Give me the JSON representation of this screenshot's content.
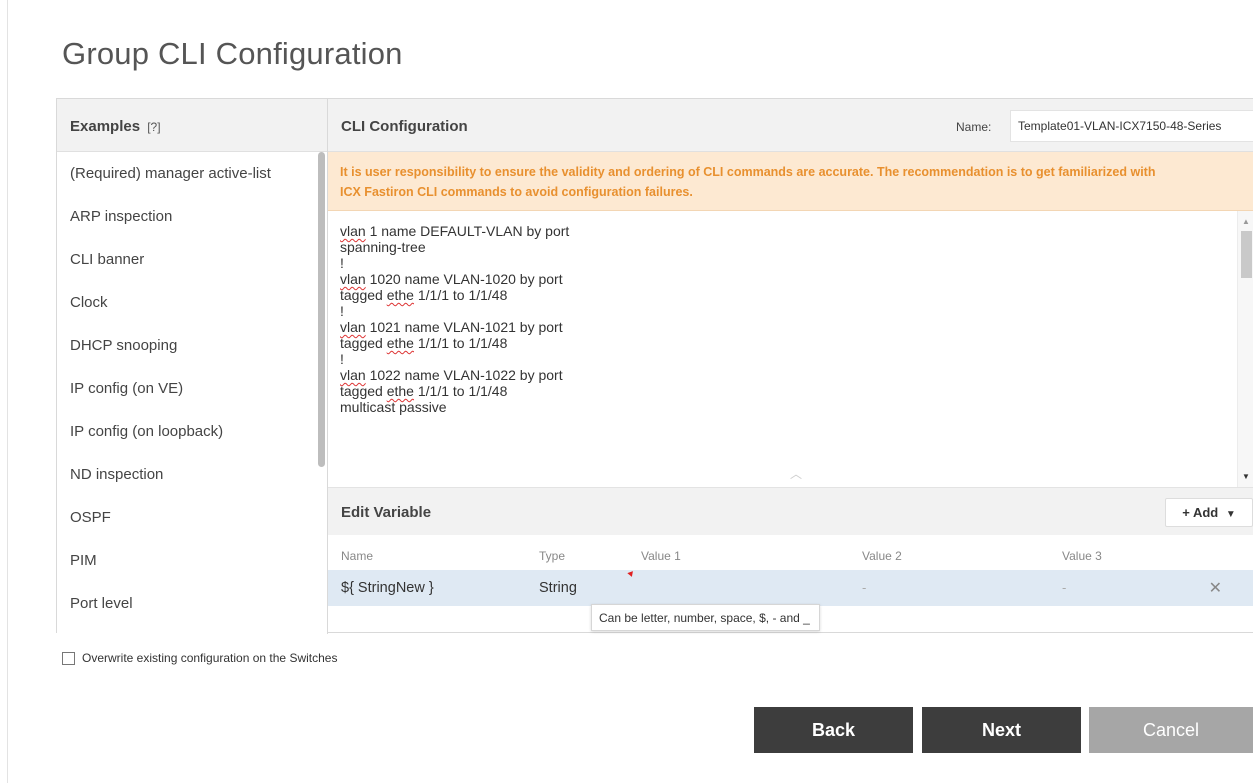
{
  "page": {
    "title": "Group CLI Configuration"
  },
  "examples": {
    "header": "Examples",
    "help": "[?]",
    "items": [
      "(Required) manager active-list",
      "ARP inspection",
      "CLI banner",
      "Clock",
      "DHCP snooping",
      "IP config (on VE)",
      "IP config (on loopback)",
      "ND inspection",
      "OSPF",
      "PIM",
      "Port level"
    ]
  },
  "cli": {
    "header": "CLI Configuration",
    "name_label": "Name:",
    "name_value": "Template01-VLAN-ICX7150-48-Series",
    "warning_line1": "It is user responsibility to ensure the validity and ordering of CLI commands are accurate. The recommendation is to get familiarized with",
    "warning_line2": "ICX Fastiron CLI commands to avoid configuration failures.",
    "lines": [
      {
        "a": "vlan",
        "b": " 1 name DEFAULT-VLAN by port"
      },
      {
        "a": "",
        "b": "spanning-tree"
      },
      {
        "a": "",
        "b": "!"
      },
      {
        "a": "vlan",
        "b": " 1020 name VLAN-1020 by port"
      },
      {
        "a": "tagged ",
        "w": "ethe",
        "b": " 1/1/1 to 1/1/48"
      },
      {
        "a": "",
        "b": "!"
      },
      {
        "a": "vlan",
        "b": " 1021 name VLAN-1021 by port"
      },
      {
        "a": "tagged ",
        "w": "ethe",
        "b": " 1/1/1 to 1/1/48"
      },
      {
        "a": "",
        "b": "!"
      },
      {
        "a": "vlan",
        "b": " 1022 name VLAN-1022 by port"
      },
      {
        "a": "tagged ",
        "w": "ethe",
        "b": " 1/1/1 to 1/1/48"
      },
      {
        "a": "",
        "b": "multicast passive"
      }
    ]
  },
  "edit_variable": {
    "header": "Edit Variable",
    "add_label": "+ Add",
    "add_caret": "▼",
    "columns": {
      "name": "Name",
      "type": "Type",
      "value1": "Value 1",
      "value2": "Value 2",
      "value3": "Value 3"
    },
    "row": {
      "name": "${ StringNew }",
      "type": "String",
      "value1": "",
      "value2": "-",
      "value3": "-",
      "delete": "✕"
    },
    "tooltip": "Can be letter, number, space, $, - and _"
  },
  "overwrite_label": "Overwrite existing configuration on the Switches",
  "buttons": {
    "back": "Back",
    "next": "Next",
    "cancel": "Cancel"
  }
}
